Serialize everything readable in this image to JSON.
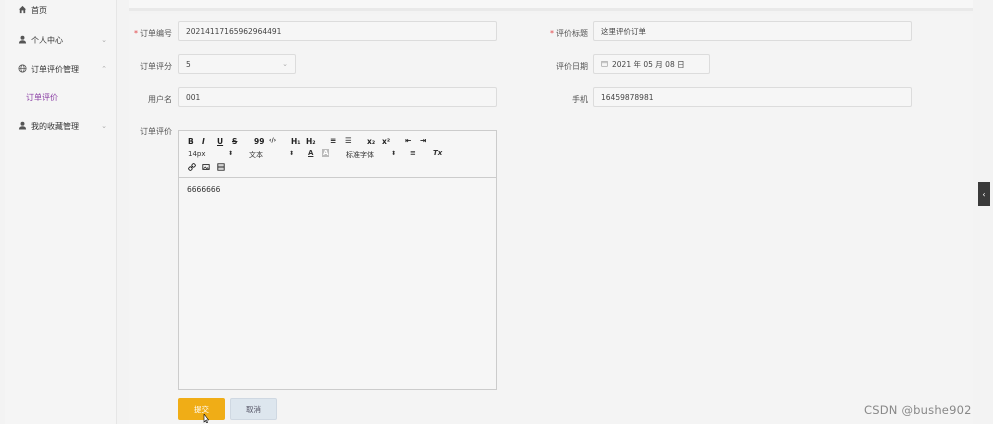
{
  "sidebar": {
    "items": [
      {
        "label": "首页",
        "icon": "home-icon"
      },
      {
        "label": "个人中心",
        "icon": "user-icon"
      },
      {
        "label": "订单评价管理",
        "icon": "globe-icon",
        "submenu": [
          "订单评价"
        ]
      },
      {
        "label": "我的收藏管理",
        "icon": "user-icon"
      }
    ],
    "chevron_down": "⌄",
    "chevron_up": "⌃"
  },
  "form": {
    "order_no": {
      "label": "订单编号",
      "value": "20214117165962964491"
    },
    "review_title": {
      "label": "评价标题",
      "value": "这里评价订单"
    },
    "rating": {
      "label": "订单评分",
      "value": "5"
    },
    "review_date": {
      "label": "评价日期",
      "value": "2021 年 05 月 08 日"
    },
    "username": {
      "label": "用户名",
      "value": "001"
    },
    "phone": {
      "label": "手机",
      "value": "16459878981"
    },
    "review": {
      "label": "订单评价",
      "content": "6666666"
    },
    "required_mark": "*"
  },
  "editor": {
    "row1": [
      "B",
      "I",
      "U",
      "S",
      "99",
      "‹/›",
      "H₁",
      "H₂",
      "≡",
      "☰",
      "x₂",
      "x²",
      "⇤",
      "⇥"
    ],
    "font_size": "14px",
    "text_style": "文本",
    "font_family": "标准字体",
    "color_icon": "A",
    "bg_icon": "A",
    "align_icon": "≡",
    "clear_icon": "Tx",
    "row3": [
      "link",
      "image",
      "video"
    ]
  },
  "buttons": {
    "submit": "提交",
    "cancel": "取消"
  },
  "watermark": "CSDN @bushe902",
  "accent_color": "#8b3fa5",
  "submit_color": "#f0ad16"
}
